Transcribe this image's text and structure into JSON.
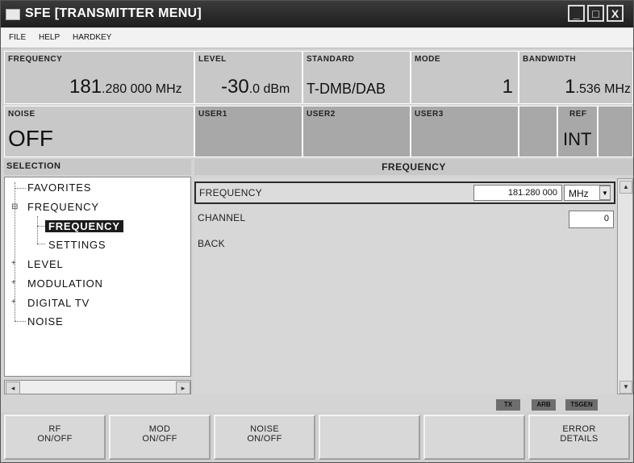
{
  "window": {
    "title": "SFE   [TRANSMITTER MENU]",
    "controls": {
      "minimize": "_",
      "maximize": "□",
      "close": "X"
    }
  },
  "menu": [
    "FILE",
    "HELP",
    "HARDKEY"
  ],
  "status": {
    "frequency": {
      "label": "FREQUENCY",
      "value_main": "181",
      "value_frac": ".280 000",
      "unit": "MHz"
    },
    "level": {
      "label": "LEVEL",
      "value_main": "-30",
      "value_frac": ".0",
      "unit": "dBm"
    },
    "standard": {
      "label": "STANDARD",
      "value": "T-DMB/DAB"
    },
    "mode": {
      "label": "MODE",
      "value": "1"
    },
    "bandwidth": {
      "label": "BANDWIDTH",
      "value_main": "1",
      "value_frac": ".536",
      "unit": "MHz"
    },
    "noise": {
      "label": "NOISE",
      "value": "OFF"
    },
    "user1": {
      "label": "USER1"
    },
    "user2": {
      "label": "USER2"
    },
    "user3": {
      "label": "USER3"
    },
    "ref": {
      "label": "REF",
      "value": "INT"
    }
  },
  "selection": {
    "header": "SELECTION",
    "items": [
      {
        "label": "FAVORITES"
      },
      {
        "label": "FREQUENCY",
        "expander": "⊟"
      },
      {
        "label": "FREQUENCY"
      },
      {
        "label": "SETTINGS"
      },
      {
        "label": "LEVEL",
        "expander": "+"
      },
      {
        "label": "MODULATION",
        "expander": "+"
      },
      {
        "label": "DIGITAL TV",
        "expander": "+"
      },
      {
        "label": "NOISE"
      }
    ]
  },
  "content": {
    "header": "FREQUENCY",
    "rows": [
      {
        "label": "FREQUENCY",
        "value": "181.280 000",
        "unit": "MHz"
      },
      {
        "label": "CHANNEL",
        "value": "0"
      },
      {
        "label": "BACK"
      }
    ]
  },
  "indicators": [
    "TX",
    "ARB",
    "TSGEN"
  ],
  "softkeys": [
    {
      "line1": "RF",
      "line2": "ON/OFF"
    },
    {
      "line1": "MOD",
      "line2": "ON/OFF"
    },
    {
      "line1": "NOISE",
      "line2": "ON/OFF"
    },
    {
      "line1": "",
      "line2": ""
    },
    {
      "line1": "",
      "line2": ""
    },
    {
      "line1": "ERROR",
      "line2": "DETAILS"
    }
  ]
}
